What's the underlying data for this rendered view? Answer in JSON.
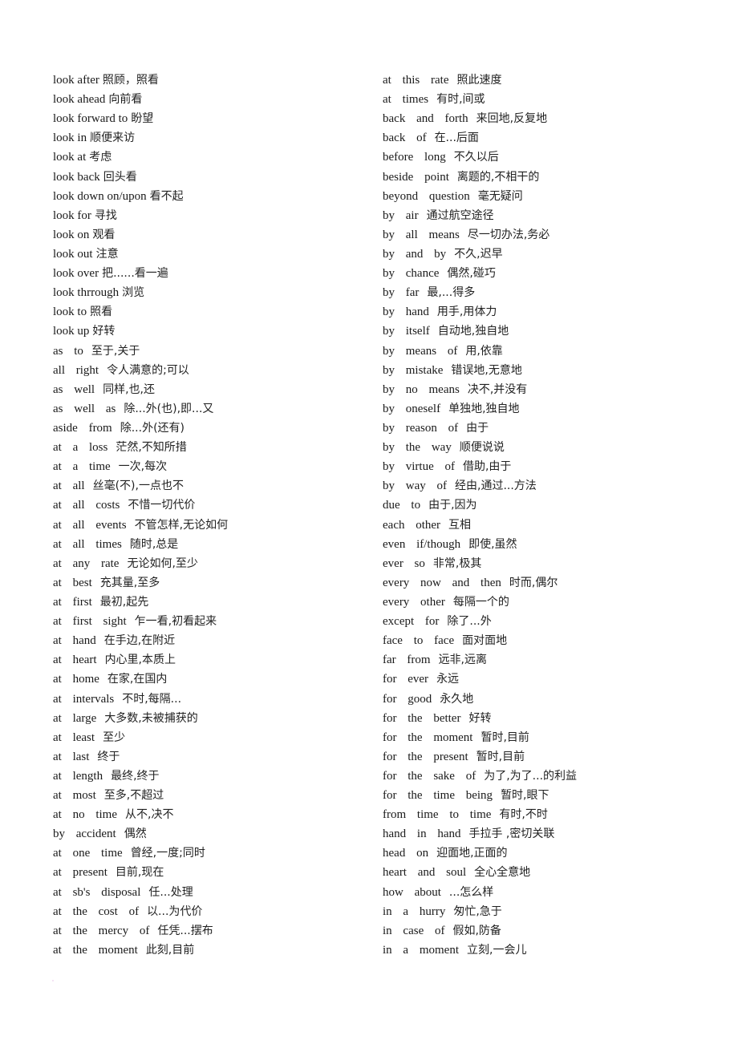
{
  "left_column": [
    {
      "phrase": "look after",
      "meaning": "照顾，照看",
      "style": "plain"
    },
    {
      "phrase": "look ahead",
      "meaning": "向前看",
      "style": "plain"
    },
    {
      "phrase": "look forward to",
      "meaning": "盼望",
      "style": "plain"
    },
    {
      "phrase": "look in",
      "meaning": "顺便来访",
      "style": "plain"
    },
    {
      "phrase": "look at",
      "meaning": "考虑",
      "style": "plain"
    },
    {
      "phrase": "look back",
      "meaning": "回头看",
      "style": "plain"
    },
    {
      "phrase": "look down on/upon",
      "meaning": "看不起",
      "style": "plain"
    },
    {
      "phrase": "look for",
      "meaning": "寻找",
      "style": "plain"
    },
    {
      "phrase": "look on",
      "meaning": "观看",
      "style": "plain"
    },
    {
      "phrase": "look out",
      "meaning": "注意",
      "style": "plain"
    },
    {
      "phrase": "look over",
      "meaning": "把......看一遍",
      "style": "plain"
    },
    {
      "phrase": "look thrrough",
      "meaning": "浏览",
      "style": "plain"
    },
    {
      "phrase": "look to",
      "meaning": "照看",
      "style": "plain"
    },
    {
      "phrase": "look up",
      "meaning": "好转",
      "style": "plain"
    },
    {
      "phrase": "as to",
      "meaning": "至于,关于",
      "style": "spaced"
    },
    {
      "phrase": "all right",
      "meaning": "令人满意的;可以",
      "style": "spaced"
    },
    {
      "phrase": "as well",
      "meaning": "同样,也,还",
      "style": "spaced"
    },
    {
      "phrase": "as well as",
      "meaning": "除...外(也),即...又",
      "style": "spaced"
    },
    {
      "phrase": "aside from",
      "meaning": "除...外(还有)",
      "style": "spaced"
    },
    {
      "phrase": "at a loss",
      "meaning": "茫然,不知所措",
      "style": "spaced"
    },
    {
      "phrase": "at a time",
      "meaning": "一次,每次",
      "style": "spaced"
    },
    {
      "phrase": "at all",
      "meaning": "丝毫(不),一点也不",
      "style": "spaced"
    },
    {
      "phrase": "at all costs",
      "meaning": "不惜一切代价",
      "style": "spaced"
    },
    {
      "phrase": "at all events",
      "meaning": "不管怎样,无论如何",
      "style": "spaced"
    },
    {
      "phrase": "at all times",
      "meaning": "随时,总是",
      "style": "spaced"
    },
    {
      "phrase": "at any rate",
      "meaning": "无论如何,至少",
      "style": "spaced"
    },
    {
      "phrase": "at best",
      "meaning": "充其量,至多",
      "style": "spaced"
    },
    {
      "phrase": "at first",
      "meaning": "最初,起先",
      "style": "spaced"
    },
    {
      "phrase": "at first sight",
      "meaning": "乍一看,初看起来",
      "style": "spaced"
    },
    {
      "phrase": "at hand",
      "meaning": "在手边,在附近",
      "style": "spaced"
    },
    {
      "phrase": "at heart",
      "meaning": "内心里,本质上",
      "style": "spaced"
    },
    {
      "phrase": "at home",
      "meaning": "在家,在国内",
      "style": "spaced"
    },
    {
      "phrase": "at intervals",
      "meaning": "不时,每隔...",
      "style": "spaced"
    },
    {
      "phrase": "at large",
      "meaning": "大多数,未被捕获的",
      "style": "spaced"
    },
    {
      "phrase": "at least",
      "meaning": "至少",
      "style": "spaced"
    },
    {
      "phrase": "at last",
      "meaning": "终于",
      "style": "spaced"
    },
    {
      "phrase": "at length",
      "meaning": "最终,终于",
      "style": "spaced"
    },
    {
      "phrase": "at most",
      "meaning": "至多,不超过",
      "style": "spaced"
    },
    {
      "phrase": "at no time",
      "meaning": "从不,决不",
      "style": "spaced"
    },
    {
      "phrase": "by accident",
      "meaning": "偶然",
      "style": "spaced"
    },
    {
      "phrase": "at one time",
      "meaning": "曾经,一度;同时",
      "style": "spaced"
    },
    {
      "phrase": "at present",
      "meaning": "目前,现在",
      "style": "spaced"
    },
    {
      "phrase": "at sb's disposal",
      "meaning": "任...处理",
      "style": "spaced"
    },
    {
      "phrase": "at the cost of",
      "meaning": "以...为代价",
      "style": "spaced"
    },
    {
      "phrase": "at the mercy of",
      "meaning": "任凭...摆布",
      "style": "spaced"
    },
    {
      "phrase": "at the moment",
      "meaning": "此刻,目前",
      "style": "spaced"
    }
  ],
  "right_column": [
    {
      "phrase": "at this rate",
      "meaning": "照此速度"
    },
    {
      "phrase": "at times",
      "meaning": "有时,间或"
    },
    {
      "phrase": "back and forth",
      "meaning": "来回地,反复地"
    },
    {
      "phrase": "back of",
      "meaning": "在...后面"
    },
    {
      "phrase": "before long",
      "meaning": "不久以后"
    },
    {
      "phrase": "beside point",
      "meaning": "离题的,不相干的"
    },
    {
      "phrase": "beyond question",
      "meaning": "毫无疑问"
    },
    {
      "phrase": "by air",
      "meaning": "通过航空途径"
    },
    {
      "phrase": "by all means",
      "meaning": "尽一切办法,务必"
    },
    {
      "phrase": "by and by",
      "meaning": "不久,迟早"
    },
    {
      "phrase": "by chance",
      "meaning": "偶然,碰巧"
    },
    {
      "phrase": "by far",
      "meaning": "最,...得多"
    },
    {
      "phrase": "by hand",
      "meaning": "用手,用体力"
    },
    {
      "phrase": "by itself",
      "meaning": "自动地,独自地"
    },
    {
      "phrase": "by means of",
      "meaning": "用,依靠"
    },
    {
      "phrase": "by mistake",
      "meaning": "错误地,无意地"
    },
    {
      "phrase": "by no means",
      "meaning": "决不,并没有"
    },
    {
      "phrase": "by oneself",
      "meaning": "单独地,独自地"
    },
    {
      "phrase": "by reason of",
      "meaning": "由于"
    },
    {
      "phrase": "by the way",
      "meaning": "顺便说说"
    },
    {
      "phrase": "by virtue of",
      "meaning": "借助,由于"
    },
    {
      "phrase": "by way of",
      "meaning": "经由,通过...方法"
    },
    {
      "phrase": "due to",
      "meaning": "由于,因为"
    },
    {
      "phrase": "each other",
      "meaning": "互相"
    },
    {
      "phrase": "even if/though",
      "meaning": "即使,虽然"
    },
    {
      "phrase": "ever so",
      "meaning": "非常,极其"
    },
    {
      "phrase": "every now and then",
      "meaning": "时而,偶尔"
    },
    {
      "phrase": "every other",
      "meaning": "每隔一个的"
    },
    {
      "phrase": "except for",
      "meaning": "除了...外"
    },
    {
      "phrase": "face to face",
      "meaning": "面对面地"
    },
    {
      "phrase": "far from",
      "meaning": "远非,远离"
    },
    {
      "phrase": "for ever",
      "meaning": "永远"
    },
    {
      "phrase": "for good",
      "meaning": "永久地"
    },
    {
      "phrase": "for the better",
      "meaning": "好转"
    },
    {
      "phrase": "for the moment",
      "meaning": "暂时,目前"
    },
    {
      "phrase": "for the present",
      "meaning": "暂时,目前"
    },
    {
      "phrase": "for the sake of",
      "meaning": "为了,为了...的利益"
    },
    {
      "phrase": "for the time being",
      "meaning": "暂时,眼下"
    },
    {
      "phrase": "from time to time",
      "meaning": "有时,不时"
    },
    {
      "phrase": "hand in hand",
      "meaning": "手拉手  ,密切关联"
    },
    {
      "phrase": "head on",
      "meaning": "迎面地,正面的"
    },
    {
      "phrase": "heart and soul",
      "meaning": "全心全意地"
    },
    {
      "phrase": "how about",
      "meaning": "...怎么样"
    },
    {
      "phrase": "in a hurry",
      "meaning": "匆忙,急于"
    },
    {
      "phrase": "in case of",
      "meaning": "假如,防备"
    },
    {
      "phrase": "in a moment",
      "meaning": "立刻,一会儿"
    }
  ]
}
